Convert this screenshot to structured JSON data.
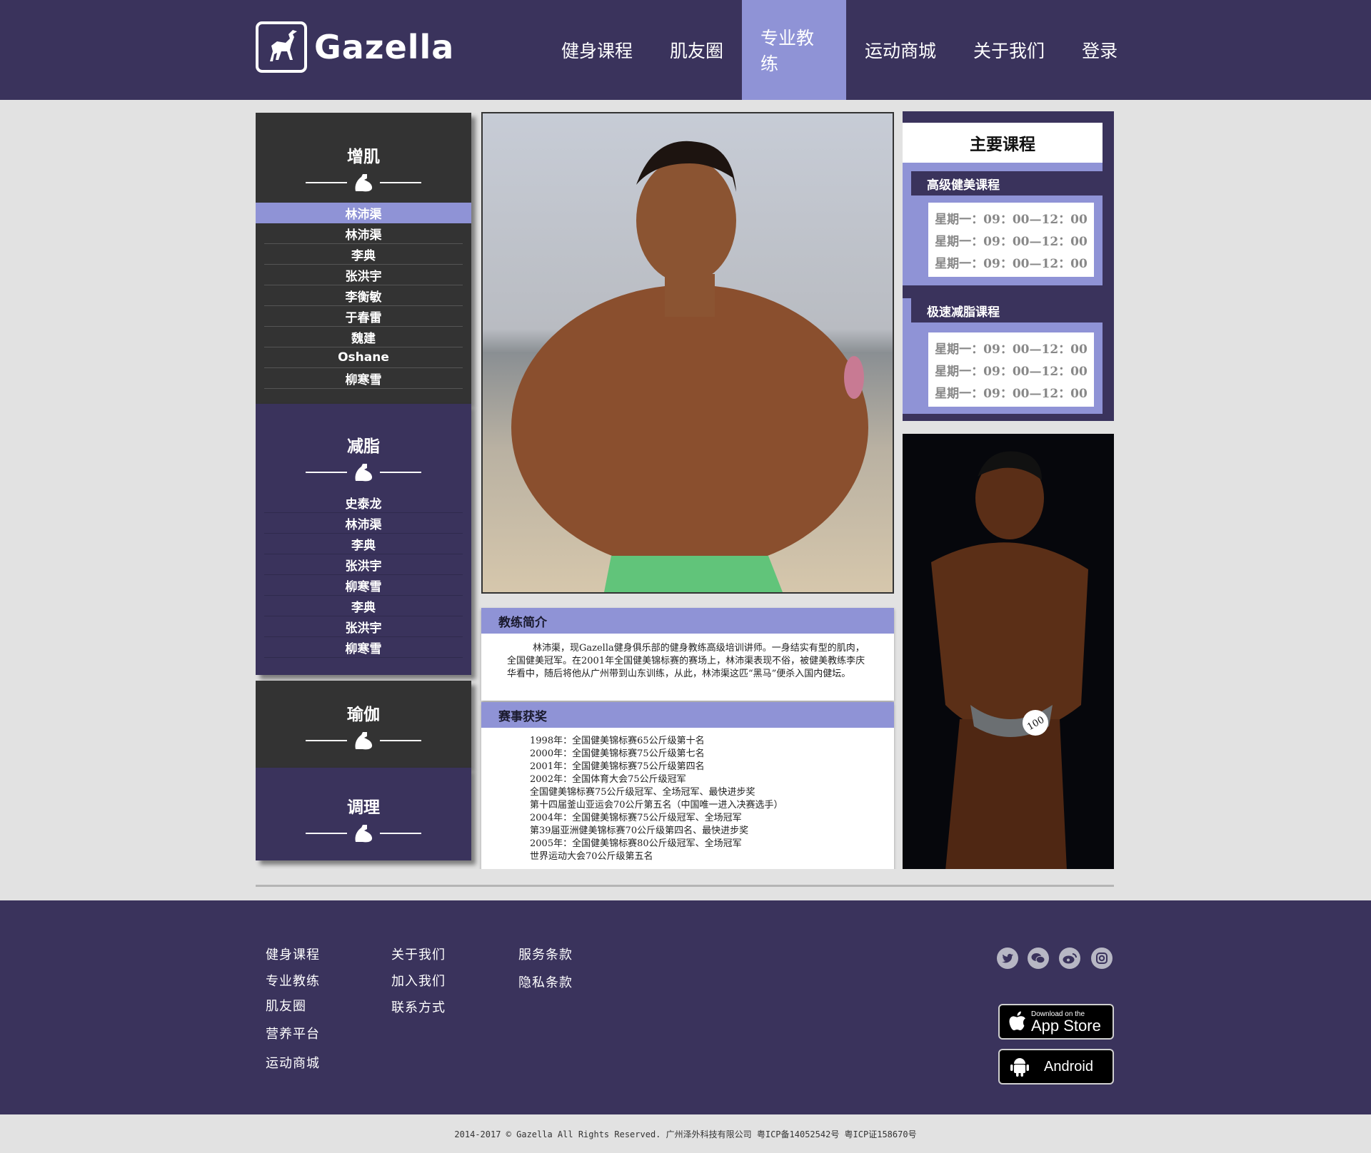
{
  "brand": {
    "name": "Gazella"
  },
  "nav": [
    {
      "label": "健身课程"
    },
    {
      "label": "肌友圈"
    },
    {
      "label": "专业教练",
      "active": true
    },
    {
      "label": "运动商城"
    },
    {
      "label": "关于我们"
    },
    {
      "label": "登录"
    }
  ],
  "categories": {
    "gain": {
      "title": "增肌",
      "items": [
        "林沛渠",
        "林沛渠",
        "李典",
        "张洪宇",
        "李衡敏",
        "于春雷",
        "魏建",
        "Oshane",
        "柳寒雪"
      ]
    },
    "fatloss": {
      "title": "减脂",
      "items": [
        "史泰龙",
        "林沛渠",
        "李典",
        "张洪宇",
        "柳寒雪",
        "李典",
        "张洪宇",
        "柳寒雪"
      ]
    },
    "yoga": {
      "title": "瑜伽"
    },
    "recovery": {
      "title": "调理"
    }
  },
  "bio": {
    "header": "教练简介",
    "text": "林沛渠，现Gazella健身俱乐部的健身教练高级培训讲师。一身结实有型的肌肉，全国健美冠军。在2001年全国健美锦标赛的赛场上，林沛渠表现不俗，被健美教练李庆华看中，随后将他从广州带到山东训练，从此，林沛渠这匹“黑马”便杀入国内健坛。"
  },
  "awards": {
    "header": "赛事获奖",
    "items": [
      "1998年：全国健美锦标赛65公斤级第十名",
      "2000年：全国健美锦标赛75公斤级第七名",
      "2001年：全国健美锦标赛75公斤级第四名",
      "2002年：全国体育大会75公斤级冠军",
      "全国健美锦标赛75公斤级冠军、全场冠军、最快进步奖",
      "第十四届釜山亚运会70公斤第五名（中国唯一进入决赛选手）",
      "2004年：全国健美锦标赛75公斤级冠军、全场冠军",
      "第39届亚洲健美锦标赛70公斤级第四名、最快进步奖",
      "2005年：全国健美锦标赛80公斤级冠军、全场冠军",
      "世界运动大会70公斤级第五名"
    ]
  },
  "courses": {
    "title": "主要课程",
    "advanced": {
      "label": "高级健美课程",
      "times": [
        "星期一：09：00—12：00",
        "星期一：09：00—12：00",
        "星期一：09：00—12：00"
      ]
    },
    "fastloss": {
      "label": "极速减脂课程",
      "times": [
        "星期一：09：00—12：00",
        "星期一：09：00—12：00",
        "星期一：09：00—12：00"
      ]
    }
  },
  "footer": {
    "col1": [
      "健身课程",
      "专业教练",
      "肌友圈",
      "营养平台",
      "运动商城"
    ],
    "col2": [
      "关于我们",
      "加入我们",
      "联系方式"
    ],
    "col3": [
      "服务条款",
      "隐私条款"
    ],
    "social_icons": [
      "twitter-icon",
      "wechat-icon",
      "weibo-icon",
      "instagram-icon"
    ],
    "appstore": {
      "small": "Download on the",
      "big": "App Store"
    },
    "android": {
      "label": "Android"
    },
    "copyright": "2014-2017 © Gazella All Rights Reserved. 广州泽外科技有限公司 粤ICP备14052542号 粤ICP证158670号"
  },
  "photo_badge": "100",
  "colors": {
    "header_bg": "#3a335c",
    "accent": "#8f93d6",
    "dark_panel": "#333333",
    "page_bg": "#e2e2e2"
  }
}
